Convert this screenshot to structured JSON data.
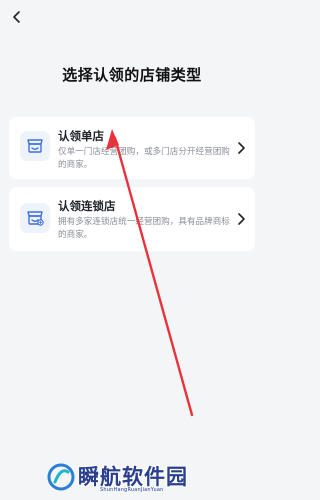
{
  "header": {
    "back_icon": "chevron-left-icon",
    "title": "选择认领的店铺类型"
  },
  "cards": [
    {
      "title": "认领单店",
      "description": "仅单一门店经营团购，或多门店分开经营团购的商家。",
      "icon": "single-store-icon"
    },
    {
      "title": "认领连锁店",
      "description": "拥有多家连锁店统一经营团购，具有品牌商标的商家。",
      "icon": "chain-store-icon"
    }
  ],
  "annotation": {
    "arrow_color": "#e8323c"
  },
  "watermark": {
    "text": "瞬航软件园",
    "subtext": "ShunHangRuanJianYuan"
  },
  "colors": {
    "background": "#f4f5f7",
    "card": "#ffffff",
    "icon_accent": "#3d6fe0"
  }
}
